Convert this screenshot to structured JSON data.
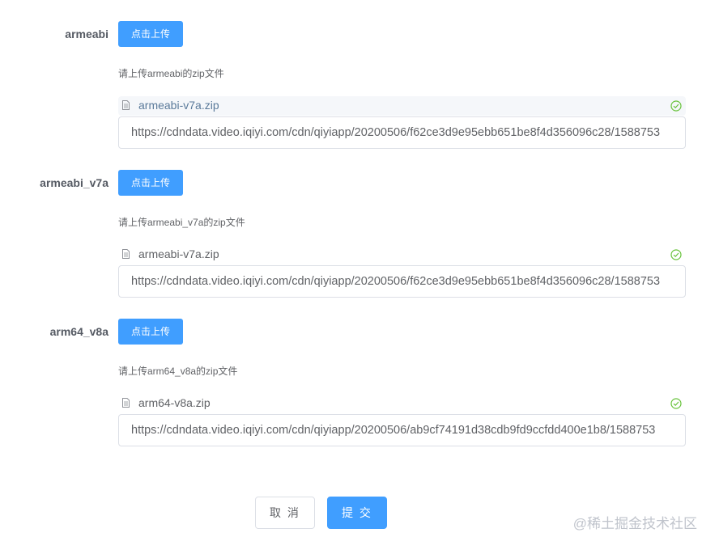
{
  "rows": [
    {
      "label": "armeabi",
      "upload_button": "点击上传",
      "tip": "请上传armeabi的zip文件",
      "file_name": "armeabi-v7a.zip",
      "url": "https://cdndata.video.iqiyi.com/cdn/qiyiapp/20200506/f62ce3d9e95ebb651be8f4d356096c28/1588753"
    },
    {
      "label": "armeabi_v7a",
      "upload_button": "点击上传",
      "tip": "请上传armeabi_v7a的zip文件",
      "file_name": "armeabi-v7a.zip",
      "url": "https://cdndata.video.iqiyi.com/cdn/qiyiapp/20200506/f62ce3d9e95ebb651be8f4d356096c28/1588753"
    },
    {
      "label": "arm64_v8a",
      "upload_button": "点击上传",
      "tip": "请上传arm64_v8a的zip文件",
      "file_name": "arm64-v8a.zip",
      "url": "https://cdndata.video.iqiyi.com/cdn/qiyiapp/20200506/ab9cf74191d38cdb9fd9ccfdd400e1b8/1588753"
    }
  ],
  "footer": {
    "cancel_label": "取 消",
    "submit_label": "提 交"
  },
  "watermark": "@稀土掘金技术社区",
  "colors": {
    "primary": "#409eff",
    "success": "#67c23a",
    "text": "#606266",
    "border": "#dcdfe6"
  },
  "icons": {
    "file": "document-icon",
    "status": "circle-check-icon"
  }
}
